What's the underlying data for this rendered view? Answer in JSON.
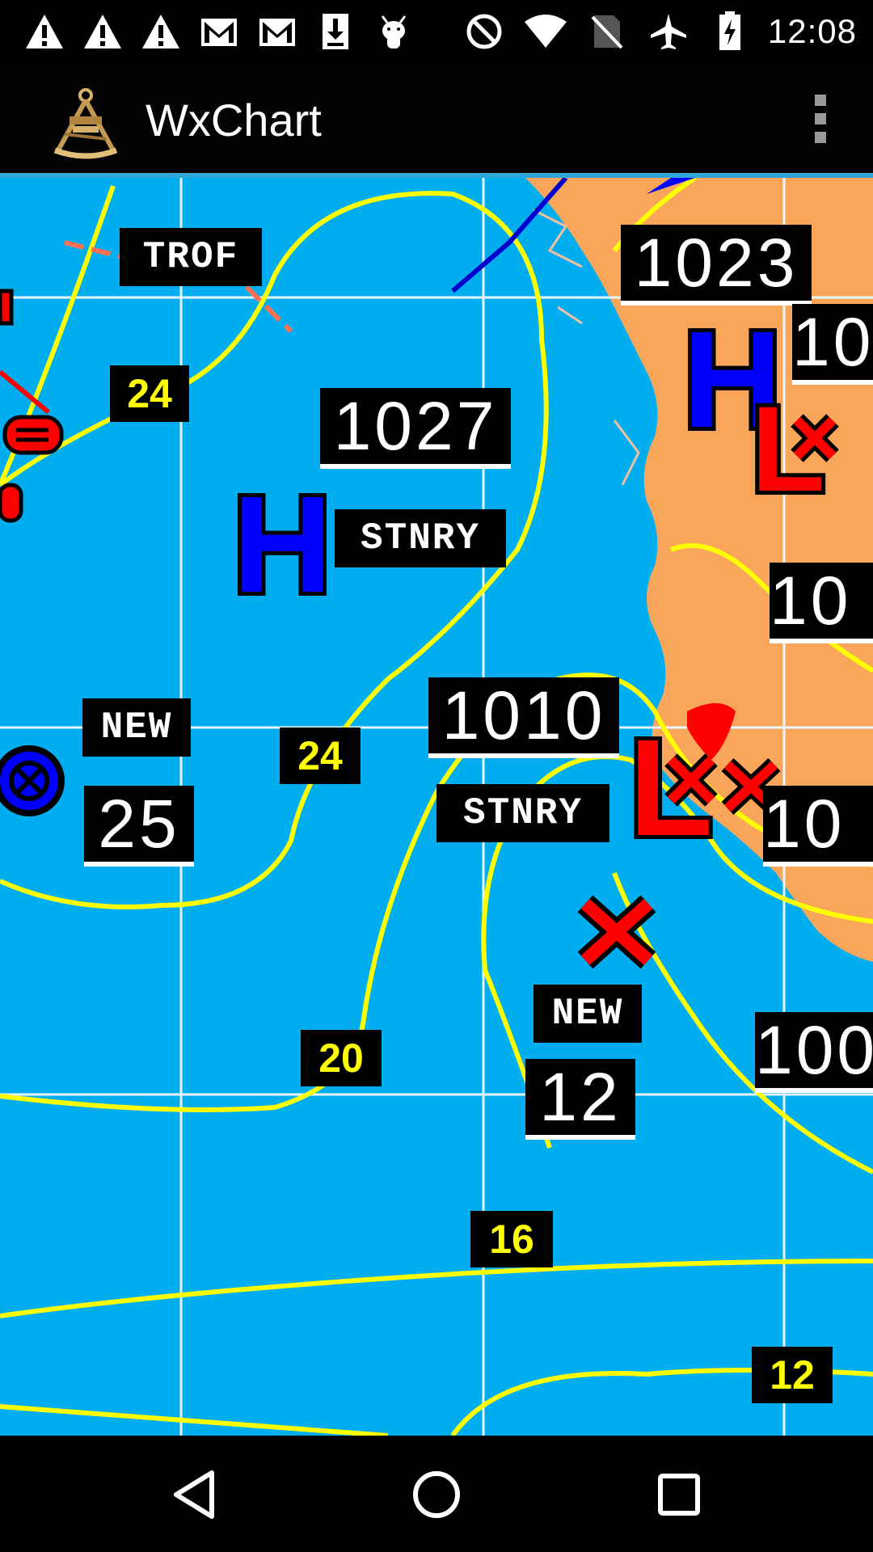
{
  "status_bar": {
    "time": "12:08",
    "left_icons": [
      "warning-icon",
      "warning-icon",
      "warning-icon",
      "gmail-icon",
      "gmail-icon",
      "download-icon",
      "android-debug-icon"
    ],
    "right_icons": [
      "do-not-disturb-icon",
      "wifi-icon",
      "no-sim-icon",
      "airplane-mode-icon",
      "battery-charging-icon"
    ]
  },
  "app_bar": {
    "title": "WxChart",
    "logo_icon": "sextant-logo-icon",
    "menu_icon": "overflow-menu-icon"
  },
  "map": {
    "colors": {
      "ocean": "#00aeef",
      "land": "#f9a65a",
      "isobar": "#ffff00",
      "high": "#0000ff",
      "low": "#ff0000",
      "grid": "#ffffff"
    },
    "labels": {
      "trof": "TROF",
      "p1023": "1023",
      "p10_a": "10",
      "p1027": "1027",
      "stnry_1": "STNRY",
      "p10_b": "10",
      "new_1": "NEW",
      "p25": "25",
      "p1010": "1010",
      "stnry_2": "STNRY",
      "p10_c": "10",
      "new_2": "NEW",
      "p12": "12",
      "p100": "100",
      "iso24_a": "24",
      "iso24_b": "24",
      "iso20": "20",
      "iso16": "16",
      "iso12": "12",
      "high_1": "H",
      "high_2": "H",
      "low_1": "L",
      "low_2": "L"
    }
  },
  "nav_bar": {
    "back_icon": "back-icon",
    "home_icon": "home-icon",
    "recents_icon": "recents-icon"
  }
}
